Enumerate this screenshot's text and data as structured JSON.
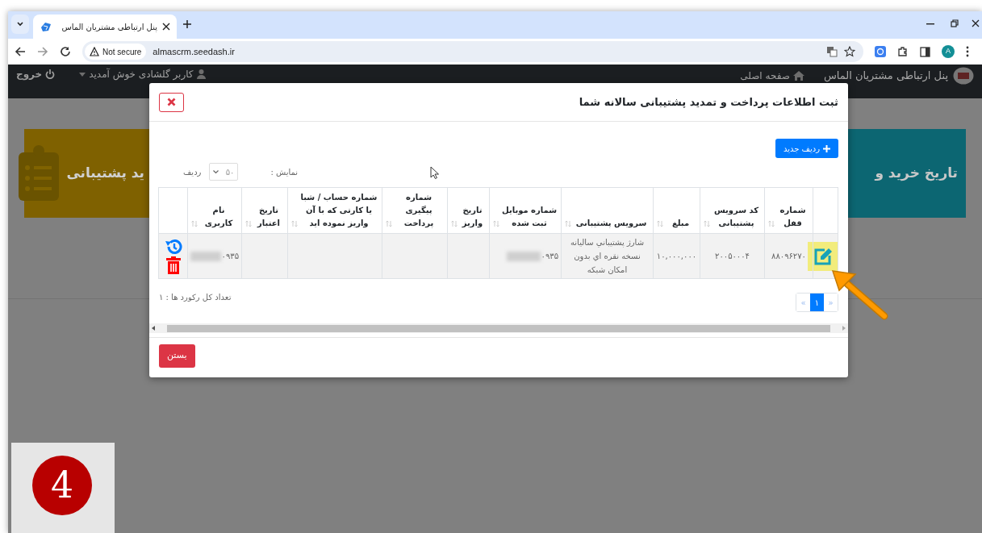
{
  "browser": {
    "tab_title": "پنل ارتباطی مشتریان الماس",
    "security": "Not secure",
    "url": "almascrm.seedash.ir",
    "profile_initial": "A"
  },
  "navbar": {
    "brand": "پنل ارتباطی مشتریان الماس",
    "home_link": "صفحه اصلی",
    "user_menu": "کاربر گلشادی خوش آمدید",
    "logout": "خروج"
  },
  "cards": [
    {
      "text": "تاریخ خرید و",
      "color": "#0c6672"
    },
    {
      "text": "ید پشتیبانی",
      "color": "#7f6100"
    }
  ],
  "modal": {
    "title": "ثبت اطلاعات پرداخت و تمدید پشتیبانی سالانه شما",
    "add_button": "ردیف جدید",
    "show_label": "نمایش :",
    "page_size": "۵۰",
    "rows_label": "ردیف",
    "table": {
      "columns": [
        "",
        "شماره قفل",
        "کد سرویس پشتیبانی",
        "مبلغ",
        "سرویس پشتیبانی",
        "شماره موبایل ثبت شده",
        "تاریخ واریز",
        "شماره پیگیری پرداخت",
        "شماره حساب / شبا یا کارتی که با آن واریز نموده اید",
        "تاریخ اعتبار",
        "نام کاربری",
        ""
      ],
      "rows": [
        {
          "cells": [
            {
              "kind": "edit"
            },
            {
              "kind": "text",
              "text": "۸۸۰۹۶۲۷۰"
            },
            {
              "kind": "text",
              "text": "۲۰۰۵۰۰۰۴"
            },
            {
              "kind": "text",
              "text": "۱۰,۰۰۰,۰۰۰"
            },
            {
              "kind": "text",
              "text": "شارژ پشتيباني ساليانه نسخه نقره اي بدون امكان شبكه"
            },
            {
              "kind": "redacted",
              "text": "۰۹۳۵"
            },
            {
              "kind": "text"
            },
            {
              "kind": "text"
            },
            {
              "kind": "text"
            },
            {
              "kind": "text"
            },
            {
              "kind": "redacted",
              "text": "۰۹۳۵"
            },
            {
              "kind": "actions"
            }
          ]
        }
      ]
    },
    "total_records": "تعداد کل رکورد ها : ۱",
    "pagination": [
      {
        "label": "«",
        "selected": false
      },
      {
        "label": "۱",
        "selected": true
      },
      {
        "label": "»",
        "selected": false
      }
    ],
    "close_button": "بستن"
  },
  "step_badge": "4"
}
